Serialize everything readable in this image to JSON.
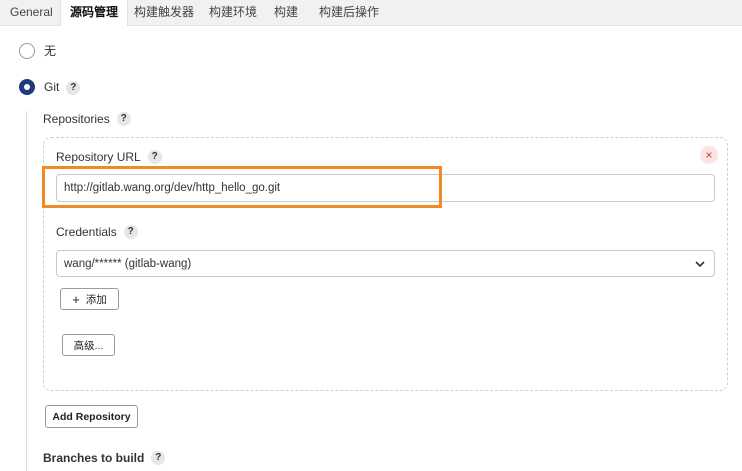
{
  "tabs": [
    {
      "label": "General"
    },
    {
      "label": "源码管理"
    },
    {
      "label": "构建触发器"
    },
    {
      "label": "构建环境"
    },
    {
      "label": "构建"
    },
    {
      "label": "构建后操作"
    }
  ],
  "scm": {
    "none_label": "无",
    "git_label": "Git",
    "help_glyph": "?",
    "selected": "Git"
  },
  "repositories": {
    "title": "Repositories",
    "repo_url_label": "Repository URL",
    "repo_url_value": "http://gitlab.wang.org/dev/http_hello_go.git",
    "remove_glyph": "×",
    "credentials_label": "Credentials",
    "credentials_value": "wang/****** (gitlab-wang)",
    "add_button_icon": "+",
    "add_button_label": "添加",
    "advanced_button_label": "高级...",
    "add_repository_label": "Add Repository"
  },
  "branches": {
    "title": "Branches to build"
  },
  "colors": {
    "accent": "#1e3a7a",
    "highlight": "#f08a24",
    "remove": "#d33333"
  }
}
